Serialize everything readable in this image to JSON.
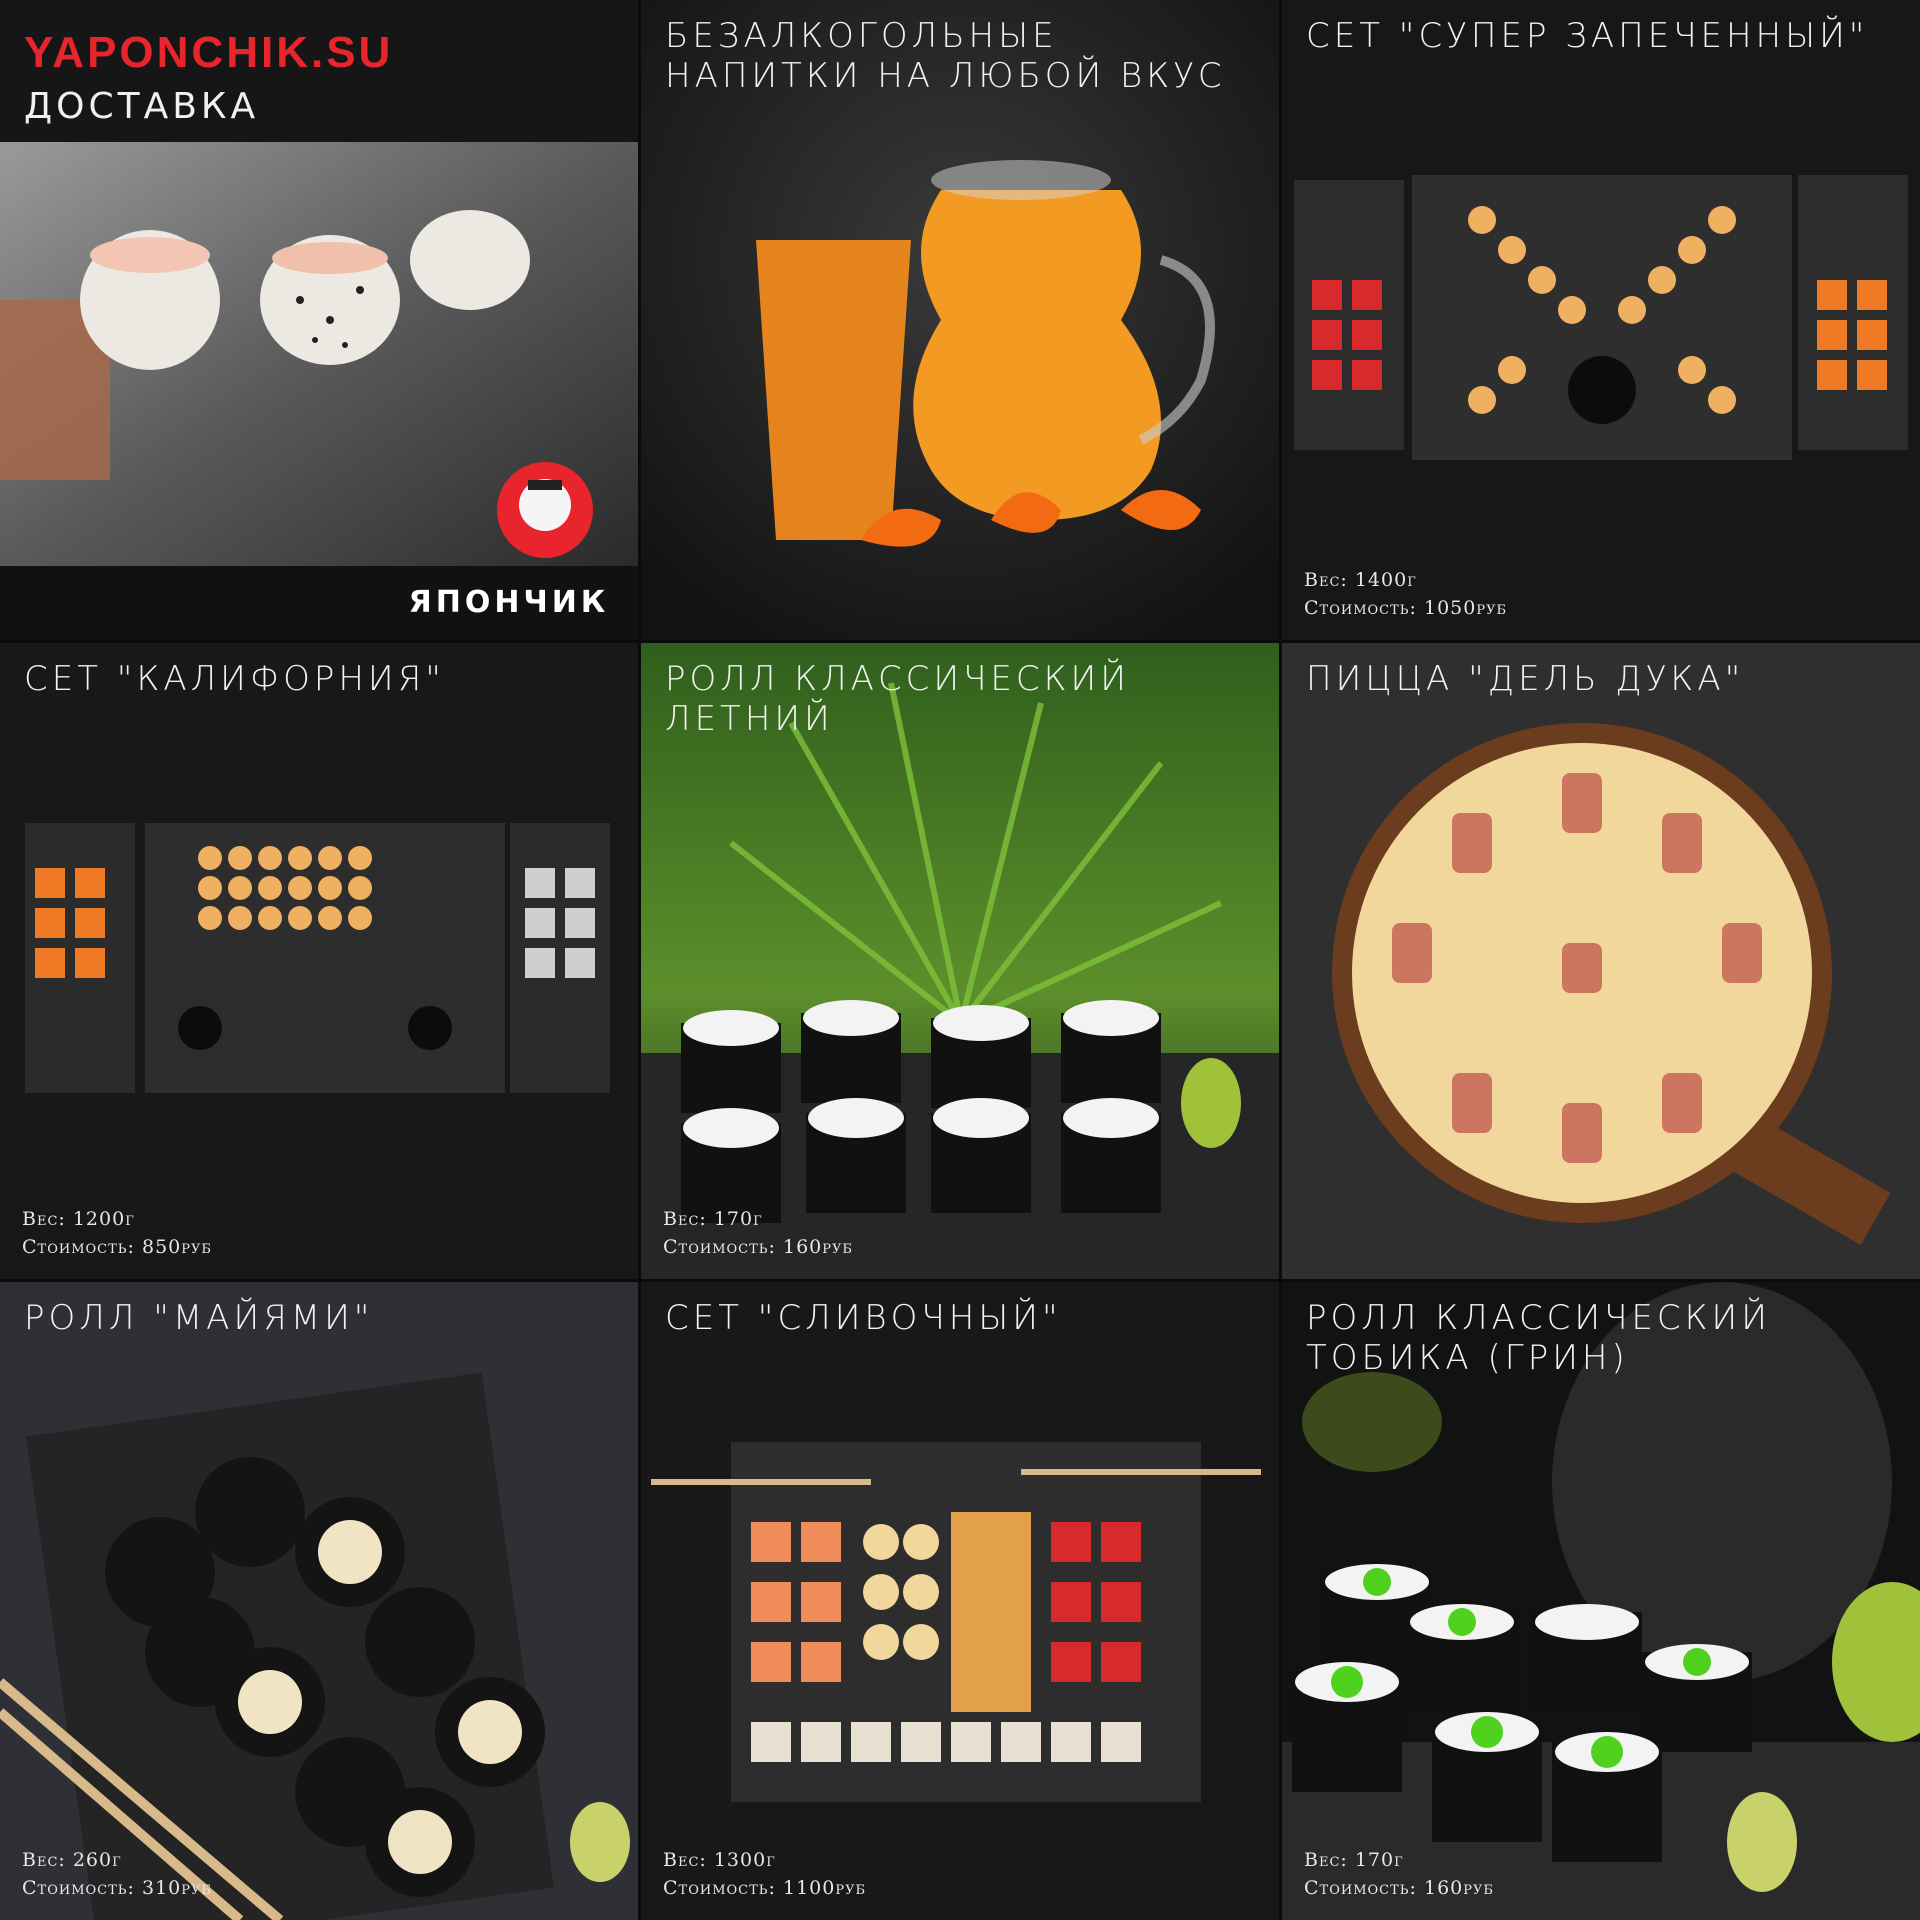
{
  "tiles": [
    {
      "brand": "YAPONCHIK.SU",
      "subtitle": "ДОСТАВКА",
      "logo_text": "ЯПОНЧИК"
    },
    {
      "title": "БЕЗАЛКОГОЛЬНЫЕ НАПИТКИ НА ЛЮБОЙ ВКУС"
    },
    {
      "title": "СЕТ \"СУПЕР ЗАПЕЧЕННЫЙ\"",
      "weight": "Вес: 1400г",
      "price": "Стоимость: 1050руб"
    },
    {
      "title": "СЕТ \"КАЛИФОРНИЯ\"",
      "weight": "Вес: 1200г",
      "price": "Стоимость: 850руб"
    },
    {
      "title": "РОЛЛ КЛАССИЧЕСКИЙ ЛЕТНИЙ",
      "weight": "Вес: 170г",
      "price": "Стоимость: 160руб"
    },
    {
      "title": "ПИЦЦА \"ДЕЛЬ ДУКА\""
    },
    {
      "title": "РОЛЛ \"МАЙЯМИ\"",
      "weight": "Вес: 260г",
      "price": "Стоимость: 310руб"
    },
    {
      "title": "СЕТ \"СЛИВОЧНЫЙ\"",
      "weight": "Вес: 1300г",
      "price": "Стоимость: 1100руб"
    },
    {
      "title": "РОЛЛ КЛАССИЧЕСКИЙ ТОБИКА (ГРИН)",
      "weight": "Вес: 170г",
      "price": "Стоимость: 160руб"
    }
  ],
  "colors": {
    "brand_red": "#e8252c",
    "background": "#0b0b0b",
    "text": "#f2f2f2"
  },
  "icons": [
    "samurai-logo-icon"
  ]
}
